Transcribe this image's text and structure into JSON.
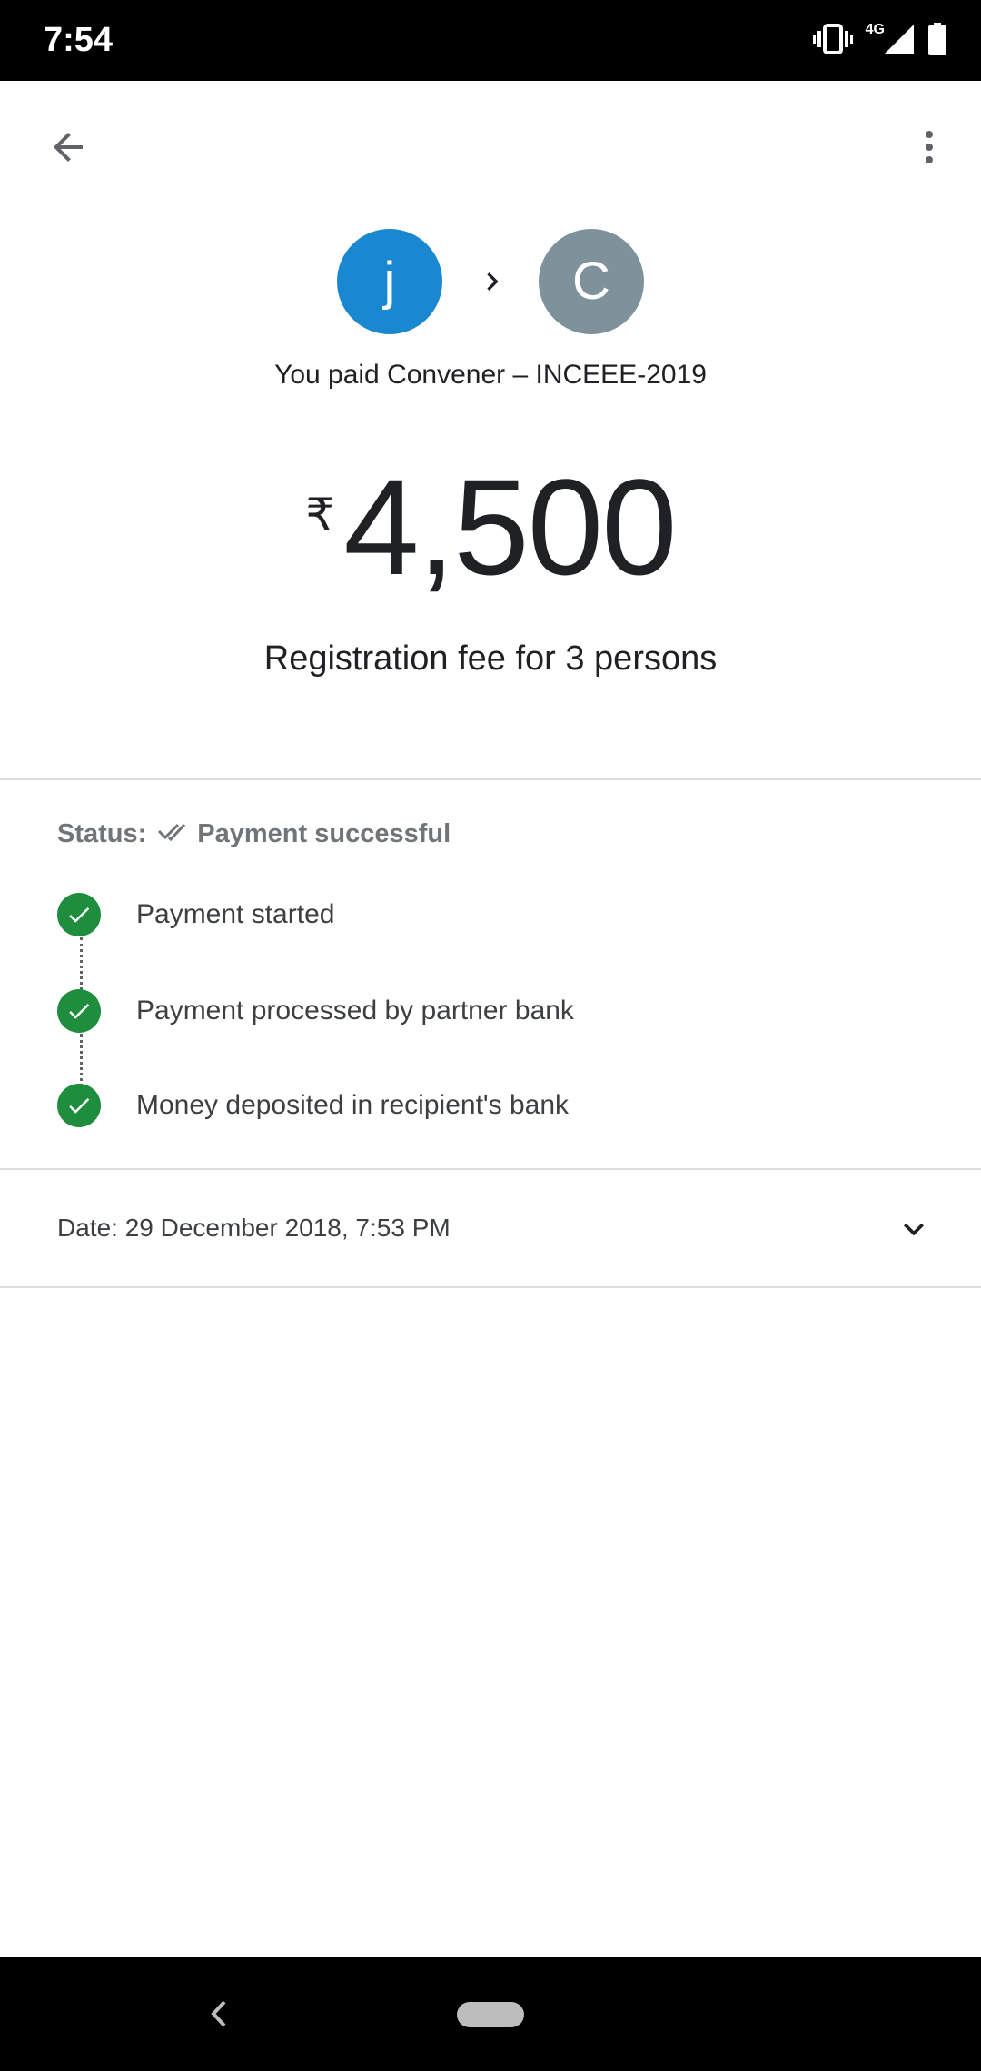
{
  "status_bar": {
    "time": "7:54",
    "network": "4G",
    "icons": [
      "vibrate-icon",
      "signal-icon",
      "battery-icon"
    ]
  },
  "app_bar": {
    "back_icon": "arrow-back-icon",
    "menu_icon": "more-vert-icon"
  },
  "header": {
    "payer_initial": "j",
    "payee_initial": "C",
    "payer_color": "#1a88d0",
    "payee_color": "#7e929b",
    "summary": "You paid Convener – INCEEE-2019"
  },
  "payment": {
    "currency_symbol": "₹",
    "amount": "4,500",
    "note": "Registration fee for 3 persons"
  },
  "status": {
    "label": "Status:",
    "value": "Payment successful",
    "steps": [
      {
        "label": "Payment started"
      },
      {
        "label": "Payment processed by partner bank"
      },
      {
        "label": "Money deposited in recipient's bank"
      }
    ],
    "success_color": "#1e8e3e"
  },
  "details": {
    "date": "Date: 29 December 2018, 7:53 PM"
  }
}
